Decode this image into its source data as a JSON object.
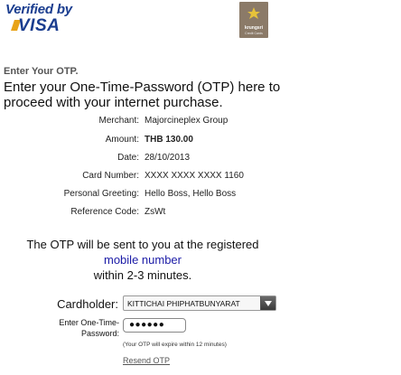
{
  "header": {
    "visa_verified_text": "Verified by",
    "visa_word": "VISA",
    "bank_name": "krungsri",
    "bank_sub": "Credit Cards"
  },
  "intro": {
    "title": "Enter Your OTP.",
    "text": "Enter your One-Time-Password (OTP) here to proceed with your internet purchase."
  },
  "details": [
    {
      "label": "Merchant:",
      "value": "Majorcineplex Group",
      "bold": false
    },
    {
      "label": "Amount:",
      "value": "THB 130.00",
      "bold": true
    },
    {
      "label": "Date:",
      "value": "28/10/2013",
      "bold": false
    },
    {
      "label": "Card Number:",
      "value": "XXXX XXXX XXXX 1160",
      "bold": false
    },
    {
      "label": "Personal Greeting:",
      "value": "Hello Boss, Hello Boss",
      "bold": false
    },
    {
      "label": "Reference Code:",
      "value": "ZsWt",
      "bold": false
    }
  ],
  "otp_message": {
    "line1": "The OTP will be sent to you at the registered",
    "link": "mobile number",
    "line3": "within 2-3 minutes."
  },
  "form": {
    "cardholder_label": "Cardholder:",
    "cardholder_value": "KITTICHAI PHIPHATBUNYARAT",
    "password_label": "Enter One-Time-Password:",
    "password_value": "●●●●●●",
    "expire_note": "(Your OTP will expire within 12 minutes)",
    "resend_label": "Resend OTP"
  },
  "colors": {
    "visa_blue": "#1a3d8f",
    "visa_gold": "#e8a318",
    "bank_brown": "#8b7a68",
    "link_blue": "#1a1aa6"
  }
}
